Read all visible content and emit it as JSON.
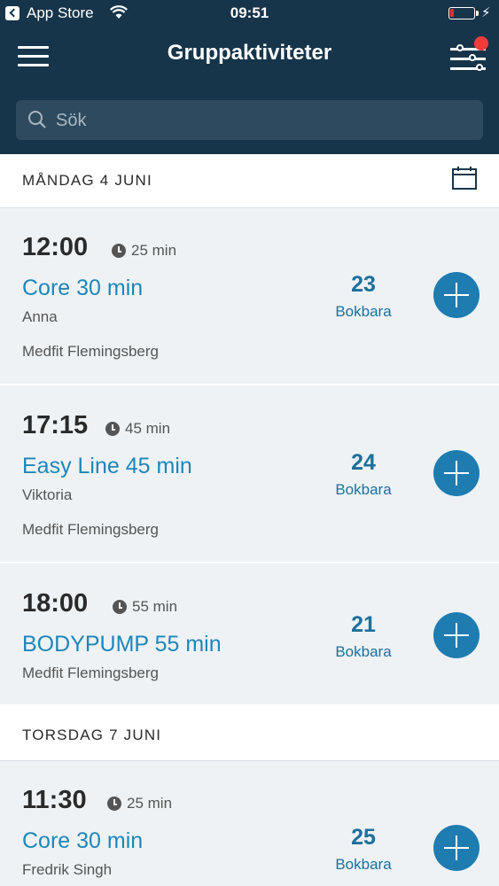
{
  "status_bar": {
    "carrier": "App Store",
    "time": "09:51"
  },
  "header": {
    "title": "Gruppaktiviteter",
    "search_placeholder": "Sök"
  },
  "days": [
    {
      "label": "MÅNDAG 4 JUNI"
    },
    {
      "label": "TORSDAG 7 JUNI"
    }
  ],
  "activities": [
    {
      "time": "12:00",
      "duration": "25 min",
      "name": "Core 30 min",
      "instructor": "Anna",
      "location": "Medfit Flemingsberg",
      "available": "23",
      "available_label": "Bokbara"
    },
    {
      "time": "17:15",
      "duration": "45 min",
      "name": "Easy Line 45 min",
      "instructor": "Viktoria",
      "location": "Medfit Flemingsberg",
      "available": "24",
      "available_label": "Bokbara"
    },
    {
      "time": "18:00",
      "duration": "55 min",
      "name": "BODYPUMP 55 min",
      "location": "Medfit Flemingsberg",
      "available": "21",
      "available_label": "Bokbara"
    },
    {
      "time": "11:30",
      "duration": "25 min",
      "name": "Core 30 min",
      "instructor": "Fredrik Singh",
      "available": "25",
      "available_label": "Bokbara"
    }
  ]
}
